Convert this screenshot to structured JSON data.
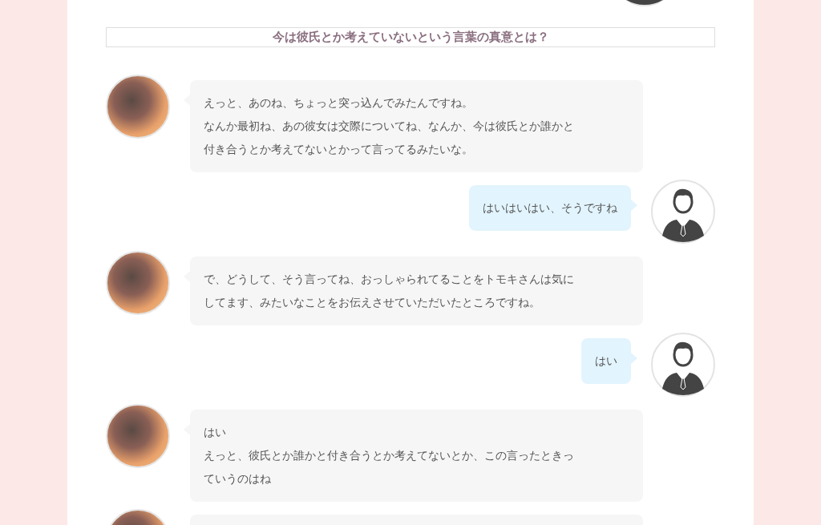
{
  "heading": "今は彼氏とか考えていないという言葉の真意とは？",
  "messages": [
    {
      "kind": "right"
    },
    {
      "kind": "left",
      "lines": [
        "えっと、あのね、ちょっと突っ込んでみたんですね。",
        "なんか最初ね、あの彼女は交際についてね、なんか、今は彼氏とか誰かと",
        "付き合うとか考えてないとかって言ってるみたいな。"
      ]
    },
    {
      "kind": "right",
      "lines": [
        "はいはいはい、そうですね"
      ]
    },
    {
      "kind": "left",
      "lines": [
        "で、どうして、そう言ってね、おっしゃられてることをトモキさんは気に",
        "してます、みたいなことをお伝えさせていただいたところですね。"
      ]
    },
    {
      "kind": "right",
      "lines": [
        "はい"
      ]
    },
    {
      "kind": "left",
      "lines": [
        "はい",
        "えっと、彼氏とか誰かと付き合うとか考えてないとか、この言ったときっ",
        "ていうのはね"
      ]
    },
    {
      "kind": "left"
    }
  ]
}
